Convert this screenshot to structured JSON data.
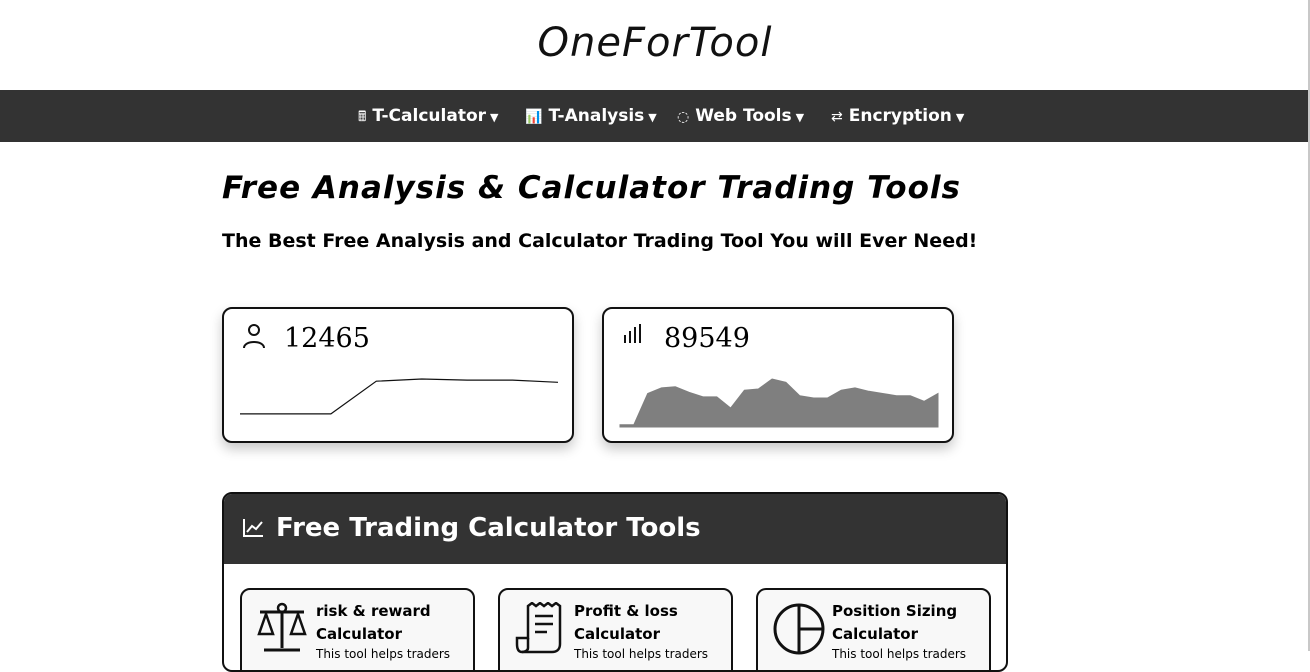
{
  "site": {
    "title": "OneForTool"
  },
  "nav": {
    "items": [
      {
        "icon": "calculator-icon",
        "glyph": "🖩",
        "label": "T-Calculator"
      },
      {
        "icon": "bar-chart-icon",
        "glyph": "📊",
        "label": "T-Analysis"
      },
      {
        "icon": "globe-icon",
        "glyph": "◌",
        "label": "Web Tools"
      },
      {
        "icon": "swap-arrows-icon",
        "glyph": "⇄",
        "label": "Encryption"
      }
    ]
  },
  "hero": {
    "title": "Free Analysis & Calculator Trading Tools",
    "subtitle": "The Best Free Analysis and Calculator Trading Tool You will Ever Need!"
  },
  "stats": [
    {
      "icon": "user-icon",
      "value": "12465",
      "spark_type": "line",
      "spark_values": [
        12,
        12,
        12,
        42,
        44,
        43,
        43,
        41
      ]
    },
    {
      "icon": "signal-bars-icon",
      "value": "89549",
      "spark_type": "area",
      "spark_values": [
        2,
        2,
        30,
        35,
        36,
        31,
        27,
        27,
        17,
        33,
        34,
        43,
        40,
        28,
        26,
        26,
        33,
        35,
        32,
        30,
        28,
        28,
        23,
        30
      ]
    }
  ],
  "tools": {
    "icon": "line-chart-icon",
    "title": "Free Trading Calculator Tools",
    "cards": [
      {
        "icon": "scales-icon",
        "title": "risk & reward Calculator",
        "desc": "This tool helps traders"
      },
      {
        "icon": "receipt-icon",
        "title": "Profit & loss Calculator",
        "desc": "This tool helps traders"
      },
      {
        "icon": "pie-chart-icon",
        "title": "Position Sizing Calculator",
        "desc": "This tool helps traders"
      }
    ]
  },
  "colors": {
    "nav_bg": "#333333",
    "spark_fill": "#7f7f7f",
    "card_border": "#111111"
  }
}
